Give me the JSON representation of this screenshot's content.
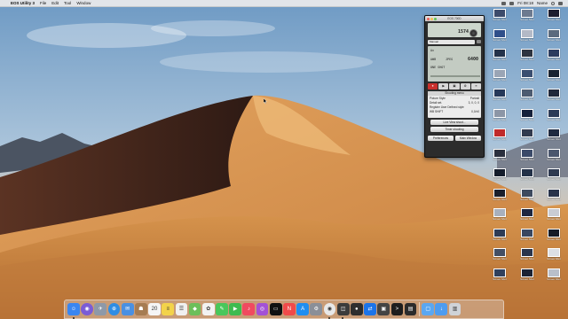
{
  "menubar": {
    "app_name": "EOS Utility 3",
    "menus": [
      "File",
      "Edit",
      "Tool",
      "Window"
    ],
    "clock": "Fri 08:18",
    "user": "Name"
  },
  "eos": {
    "window_title": "EOS 700D",
    "lcd_mode": "",
    "shots_label": "1574",
    "settings": {
      "aperture": "Av",
      "iso": "6400",
      "row_labels": [
        "AWB",
        "JPEG",
        "ONE SHOT"
      ]
    },
    "select_value": "Manual",
    "toolbar": [
      "●",
      "▶",
      "▣",
      "⚙",
      "≡"
    ],
    "picture_style": {
      "header": "Shooting menu",
      "rows": [
        {
          "label": "Picture Style",
          "value": "Portrait"
        },
        {
          "label": "Detail set.",
          "value": "3, 0, 0, 0"
        },
        {
          "label": "Register User Defined style",
          "value": ""
        },
        {
          "label": "WB SHIFT",
          "value": "0,0/±0"
        }
      ]
    },
    "buttons": {
      "live_view": "Live View shoot...",
      "timer": "Timer shooting",
      "preferences": "Preferences",
      "main_window": "Main Window"
    }
  },
  "desktop_icons": [
    {
      "caption": "Screen Shot",
      "color": "#3c4b6b"
    },
    {
      "caption": "Screen Shot",
      "color": "#6d7a8f"
    },
    {
      "caption": "Screen Shot",
      "color": "#1c1c2e"
    },
    {
      "caption": "Screen Shot",
      "color": "#2f4f8a"
    },
    {
      "caption": "Screen Shot",
      "color": "#b3b9c6"
    },
    {
      "caption": "Screen Shot",
      "color": "#5a6a7d"
    },
    {
      "caption": "Screen Shot",
      "color": "#23324a"
    },
    {
      "caption": "Screen Shot",
      "color": "#2e3440"
    },
    {
      "caption": "Screen Shot",
      "color": "#2b3c5f"
    },
    {
      "caption": "Screen Shot",
      "color": "#9aa5b5"
    },
    {
      "caption": "Screen Shot",
      "color": "#3a4e70"
    },
    {
      "caption": "Screen Shot",
      "color": "#192331"
    },
    {
      "caption": "Screen Shot",
      "color": "#263859"
    },
    {
      "caption": "Screen Shot",
      "color": "#4d5b70"
    },
    {
      "caption": "Screen Shot",
      "color": "#20283b"
    },
    {
      "caption": "Screen Shot",
      "color": "#8c96a6"
    },
    {
      "caption": "Screen Shot",
      "color": "#16213a"
    },
    {
      "caption": "Screen Shot",
      "color": "#2c3b57"
    },
    {
      "caption": "Screen Shot",
      "color": "#c02a2a"
    },
    {
      "caption": "Screen Shot",
      "color": "#323a4d"
    },
    {
      "caption": "Screen Shot",
      "color": "#1f2a40"
    },
    {
      "caption": "Screen Shot",
      "color": "#2a2f3d"
    },
    {
      "caption": "Screen Shot",
      "color": "#3b4a68"
    },
    {
      "caption": "Screen Shot",
      "color": "#4a566d"
    },
    {
      "caption": "Screen Shot",
      "color": "#141c2b"
    },
    {
      "caption": "Screen Shot",
      "color": "#223047"
    },
    {
      "caption": "Screen Shot",
      "color": "#2d3950"
    },
    {
      "caption": "Screen Shot",
      "color": "#1a1f2b"
    },
    {
      "caption": "Screen Shot",
      "color": "#3e4a5e"
    },
    {
      "caption": "Screen Shot",
      "color": "#28334a"
    },
    {
      "caption": "Screen Shot",
      "color": "#a8b0bc"
    },
    {
      "caption": "Screen Shot",
      "color": "#1d2740"
    },
    {
      "caption": "Screen Shot",
      "color": "#c9ccd3"
    },
    {
      "caption": "Screen Shot",
      "color": "#2e3c55"
    },
    {
      "caption": "Screen Shot",
      "color": "#394760"
    },
    {
      "caption": "Screen Shot",
      "color": "#151b26"
    },
    {
      "caption": "Screen Shot",
      "color": "#434f64"
    },
    {
      "caption": "Screen Shot",
      "color": "#2a354c"
    },
    {
      "caption": "Screen Shot",
      "color": "#dcdfe4"
    },
    {
      "caption": "Screen Shot",
      "color": "#30405c"
    },
    {
      "caption": "Screen Shot",
      "color": "#1b2233"
    },
    {
      "caption": "Screen Shot",
      "color": "#b9bfca"
    }
  ],
  "dock": [
    {
      "name": "finder-icon",
      "color": "#3a86f0",
      "glyph": "☺",
      "running": true
    },
    {
      "name": "siri-icon",
      "color": "#7b5cd6",
      "glyph": "◉",
      "running": false
    },
    {
      "name": "launchpad-icon",
      "color": "#8e99a8",
      "glyph": "✈",
      "running": false
    },
    {
      "name": "safari-icon",
      "color": "#2f8de4",
      "glyph": "⊕",
      "running": false
    },
    {
      "name": "mail-icon",
      "color": "#4a90e2",
      "glyph": "✉",
      "running": false
    },
    {
      "name": "contacts-icon",
      "color": "#a67c52",
      "glyph": "☗",
      "running": false
    },
    {
      "name": "calendar-icon",
      "color": "#f5f5f5",
      "glyph": "20",
      "running": false
    },
    {
      "name": "notes-icon",
      "color": "#f3d34a",
      "glyph": "≡",
      "running": false
    },
    {
      "name": "reminders-icon",
      "color": "#f0f0f0",
      "glyph": "☰",
      "running": false
    },
    {
      "name": "maps-icon",
      "color": "#6cbf5a",
      "glyph": "◆",
      "running": false
    },
    {
      "name": "photos-icon",
      "color": "#f2f2f2",
      "glyph": "✿",
      "running": false
    },
    {
      "name": "messages-icon",
      "color": "#49c75b",
      "glyph": "✎",
      "running": false
    },
    {
      "name": "facetime-icon",
      "color": "#3dbb4f",
      "glyph": "▶",
      "running": false
    },
    {
      "name": "music-icon",
      "color": "#f04a5f",
      "glyph": "♪",
      "running": false
    },
    {
      "name": "podcasts-icon",
      "color": "#a351d6",
      "glyph": "◎",
      "running": false
    },
    {
      "name": "tv-icon",
      "color": "#111111",
      "glyph": "▭",
      "running": false
    },
    {
      "name": "news-icon",
      "color": "#f04a4a",
      "glyph": "N",
      "running": false
    },
    {
      "name": "app-store-icon",
      "color": "#1f8ef1",
      "glyph": "A",
      "running": false
    },
    {
      "name": "system-preferences-icon",
      "color": "#8a8f98",
      "glyph": "⚙",
      "running": false
    },
    {
      "name": "chrome-icon",
      "color": "#e8e8e8",
      "glyph": "◉",
      "running": true
    },
    {
      "name": "eos-utility-icon",
      "color": "#3b3b3b",
      "glyph": "◫",
      "running": true
    },
    {
      "name": "camera-icon",
      "color": "#2e2e2e",
      "glyph": "●",
      "running": false
    },
    {
      "name": "teamviewer-icon",
      "color": "#1c74e9",
      "glyph": "⇄",
      "running": false
    },
    {
      "name": "screen-icon",
      "color": "#444444",
      "glyph": "▣",
      "running": false
    },
    {
      "name": "terminal-icon",
      "color": "#1e1e1e",
      "glyph": ">",
      "running": false
    },
    {
      "name": "activity-icon",
      "color": "#2b2b2b",
      "glyph": "▤",
      "running": false
    },
    {
      "name": "folder-icon",
      "color": "#5aa7f1",
      "glyph": "▢",
      "running": false
    },
    {
      "name": "downloads-icon",
      "color": "#4d9cf0",
      "glyph": "↓",
      "running": false
    },
    {
      "name": "trash-icon",
      "color": "#cfd3d8",
      "glyph": "▥",
      "running": false
    }
  ]
}
